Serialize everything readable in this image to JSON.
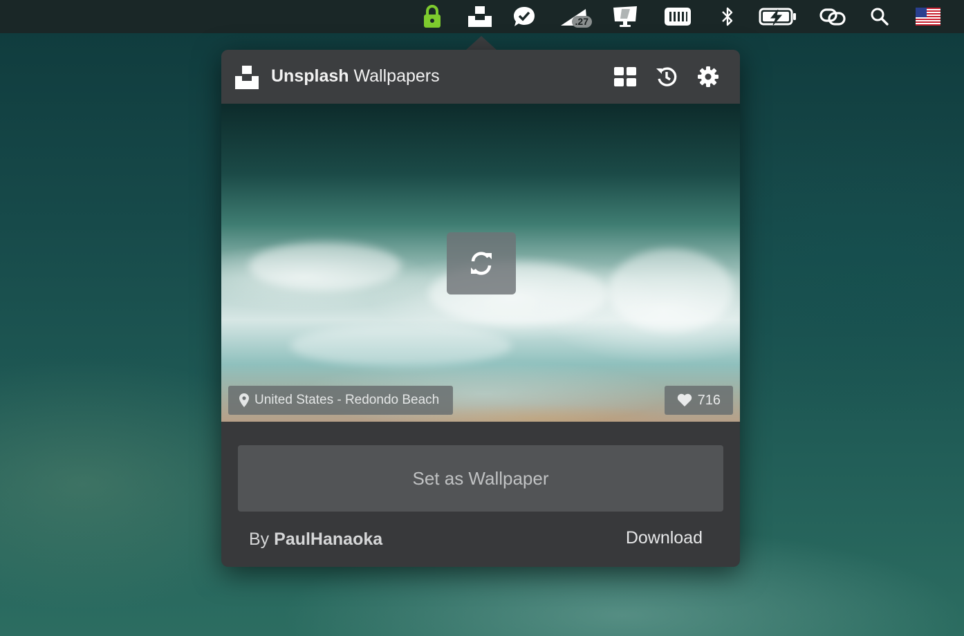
{
  "menubar": {
    "items": [
      {
        "icon": "lock-icon",
        "color": "#7ecb2e"
      },
      {
        "icon": "unsplash-icon"
      },
      {
        "icon": "checkmark-bubble-icon"
      },
      {
        "icon": "ruler-triangle-icon",
        "badge": ".27"
      },
      {
        "icon": "imac-icon"
      },
      {
        "icon": "memory-icon"
      },
      {
        "icon": "bluetooth-icon"
      },
      {
        "icon": "battery-charging-icon"
      },
      {
        "icon": "link-icon"
      },
      {
        "icon": "search-icon"
      },
      {
        "icon": "us-flag-icon"
      }
    ]
  },
  "popover": {
    "brand_bold": "Unsplash",
    "brand_rest": "Wallpapers",
    "header_icons": [
      "grid-icon",
      "history-icon",
      "gear-icon"
    ],
    "photo": {
      "location": "United States - Redondo Beach",
      "likes": "716",
      "refresh_icon": "refresh-icon"
    },
    "set_wallpaper_label": "Set as Wallpaper",
    "author_prefix": "By",
    "author_name": "PaulHanaoka",
    "download_label": "Download"
  },
  "colors": {
    "menubar_bg": "#1a2727",
    "popover_bg": "#38393b",
    "header_bg": "#3c3e40",
    "button_bg": "#525456",
    "lock_green": "#7ecb2e"
  }
}
